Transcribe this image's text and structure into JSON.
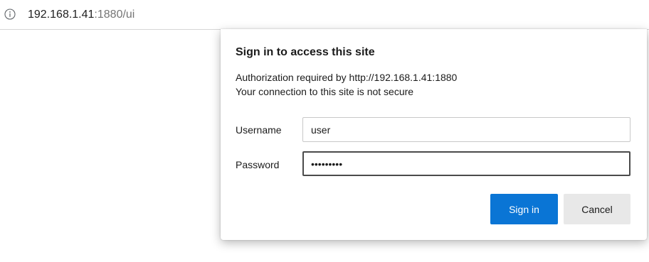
{
  "browser": {
    "url_host": "192.168.1.41",
    "url_rest": ":1880/ui",
    "info_icon": "info-circle-icon"
  },
  "dialog": {
    "title": "Sign in to access this site",
    "message_line1": "Authorization required by http://192.168.1.41:1880",
    "message_line2": "Your connection to this site is not secure",
    "username_label": "Username",
    "username_value": "user",
    "password_label": "Password",
    "password_value": "•••••••••",
    "signin_label": "Sign in",
    "cancel_label": "Cancel"
  },
  "colors": {
    "primary_button": "#0a75d5",
    "secondary_button": "#e8e8e8",
    "focused_border": "#4b4b4b"
  }
}
